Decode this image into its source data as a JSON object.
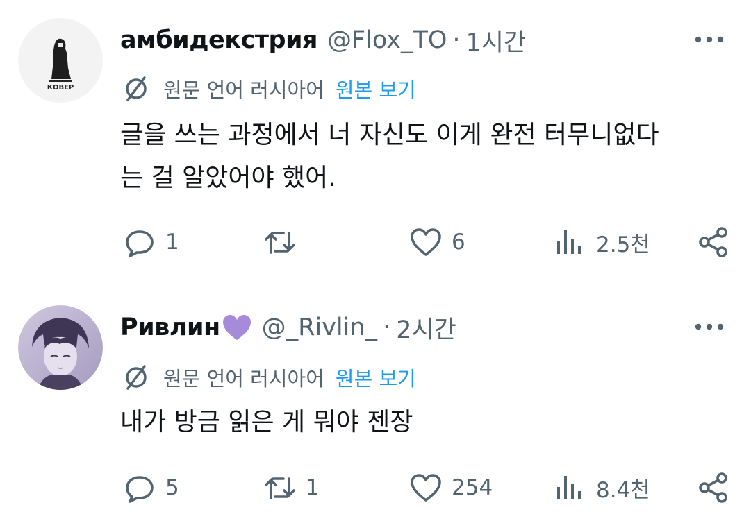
{
  "tweets": [
    {
      "display_name": "амбидекстрия",
      "handle": "@Flox_TO",
      "separator": "·",
      "time": "1시간",
      "translation_note": "원문 언어 러시아어",
      "show_original": "원본 보기",
      "text": "글을 쓰는 과정에서 너 자신도 이게 완전 터무니없다\n는 걸 알았어야 했어.",
      "avatar_logo_text": "КОВЕР",
      "stats": {
        "replies": "1",
        "retweets": "",
        "likes": "6",
        "views": "2.5천"
      }
    },
    {
      "display_name": "Ривлин",
      "name_emoji": "purple-heart-icon",
      "handle": "@_Rivlin_",
      "separator": "·",
      "time": "2시간",
      "translation_note": "원문 언어 러시아어",
      "show_original": "원본 보기",
      "text": "내가 방금 읽은 게 뭐야 젠장",
      "stats": {
        "replies": "5",
        "retweets": "1",
        "likes": "254",
        "views": "8.4천"
      }
    }
  ],
  "colors": {
    "text_primary": "#0f1419",
    "text_secondary": "#536471",
    "link": "#1d9bf0",
    "heart_emoji": "#a78bdb"
  }
}
